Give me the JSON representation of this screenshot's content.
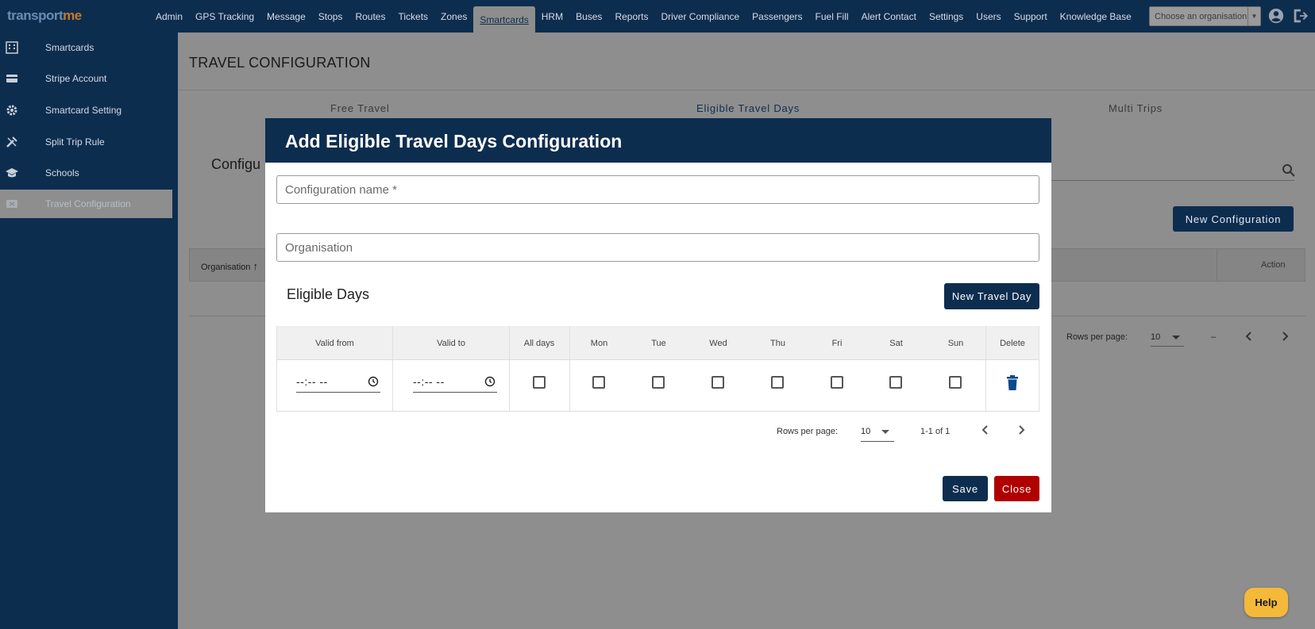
{
  "logo": {
    "part1": "transp",
    "mark": "o",
    "part2": "rt",
    "part3": "me"
  },
  "nav": {
    "items": [
      "Admin",
      "GPS Tracking",
      "Message",
      "Stops",
      "Routes",
      "Tickets",
      "Zones",
      "Smartcards",
      "HRM",
      "Buses",
      "Reports",
      "Driver Compliance",
      "Passengers",
      "Fuel Fill",
      "Alert Contact",
      "Settings",
      "Users",
      "Support",
      "Knowledge Base"
    ],
    "active": "Smartcards",
    "org_placeholder": "Choose an organisation"
  },
  "sidebar": {
    "items": [
      {
        "label": "Smartcards",
        "icon": "building-icon"
      },
      {
        "label": "Stripe Account",
        "icon": "card-icon"
      },
      {
        "label": "Smartcard Setting",
        "icon": "gear-icon"
      },
      {
        "label": "Split Trip Rule",
        "icon": "tools-icon"
      },
      {
        "label": "Schools",
        "icon": "graduation-cap-icon"
      },
      {
        "label": "Travel Configuration",
        "icon": "ticket-icon"
      }
    ],
    "active_index": 5
  },
  "page": {
    "title": "TRAVEL CONFIGURATION",
    "tabs": [
      "Free Travel",
      "Eligible Travel Days",
      "Multi Trips"
    ],
    "active_tab": "Eligible Travel Days",
    "config_label": "Configu",
    "new_config_label": "New Configuration",
    "table": {
      "col_org": "Organisation",
      "col_action": "Action"
    },
    "pager": {
      "rows_label": "Rows per page:",
      "rows_value": "10",
      "range": "–"
    }
  },
  "modal": {
    "title": "Add Eligible Travel Days Configuration",
    "config_name_placeholder": "Configuration name *",
    "organisation_placeholder": "Organisation",
    "eligible_days_title": "Eligible Days",
    "new_travel_day_label": "New Travel Day",
    "table": {
      "headers": [
        "Valid from",
        "Valid to",
        "All days",
        "Mon",
        "Tue",
        "Wed",
        "Thu",
        "Fri",
        "Sat",
        "Sun",
        "Delete"
      ],
      "rows": [
        {
          "valid_from": "--:-- --",
          "valid_to": "--:-- --",
          "all_days": false,
          "mon": false,
          "tue": false,
          "wed": false,
          "thu": false,
          "fri": false,
          "sat": false,
          "sun": false
        }
      ]
    },
    "pager": {
      "rows_label": "Rows per page:",
      "rows_value": "10",
      "range": "1-1 of 1"
    },
    "save_label": "Save",
    "close_label": "Close"
  },
  "help_label": "Help",
  "colors": {
    "primary": "#0d2d4f",
    "danger": "#b00000",
    "help": "#f5b93a",
    "delete_icon": "#0b4a8b"
  }
}
